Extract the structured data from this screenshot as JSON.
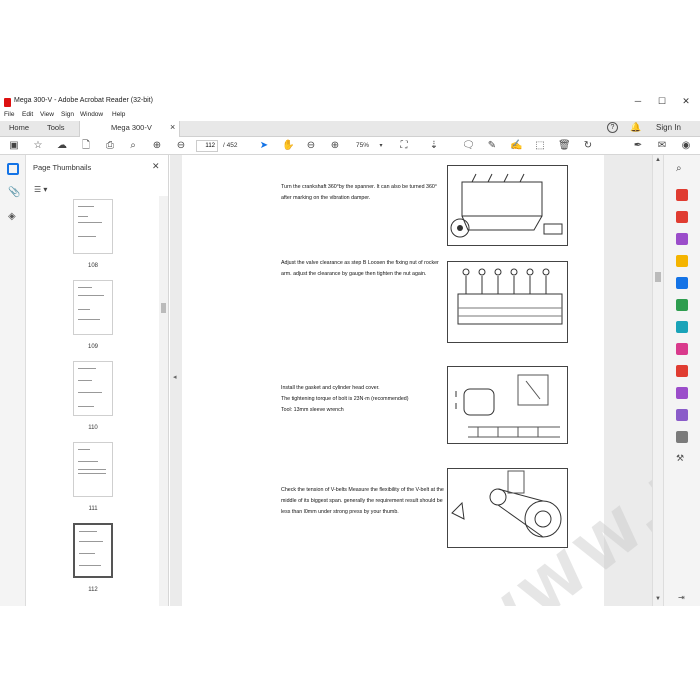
{
  "window": {
    "title": "Mega 300-V - Adobe Acrobat Reader (32-bit)",
    "minimize": "─",
    "maximize": "☐",
    "close": "✕"
  },
  "menu": [
    "File",
    "Edit",
    "View",
    "Sign",
    "Window",
    "Help"
  ],
  "tabs": {
    "home": "Home",
    "tools": "Tools",
    "document": "Mega 300-V",
    "close": "×"
  },
  "header_right": {
    "help": "?",
    "sign_in": "Sign In"
  },
  "toolbar": {
    "page_current": "112",
    "page_total": "/ 452",
    "zoom": "75%"
  },
  "thumbnails": {
    "title": "Page Thumbnails",
    "close": "✕",
    "pages": [
      "108",
      "109",
      "110",
      "111",
      "112"
    ]
  },
  "document": {
    "paragraphs": [
      "Turn the crankshaft 360°by the spanner. It can also be turned 360° after marking on the vibration damper.",
      "Adjust the valve clearance as step B Loosen the fixing nut of rocker arm. adjust the clearance by gauge then tighten the nut again.",
      "Install the gasket and cylinder head cover.\nThe tightening torque of bolt is 23N·m (recommended)\nTool: 13mm sleeve wrench",
      "Check the tension of V-belts Measure the flexibility of the V-belt at the middle of its biggest span. generally the requirement result should be less than l0mm under strong press by your thumb."
    ],
    "watermark": "WWW.EPCDEPO.COM"
  },
  "colors": {
    "accent": "#1473e6",
    "pdf_red": "#d11"
  }
}
